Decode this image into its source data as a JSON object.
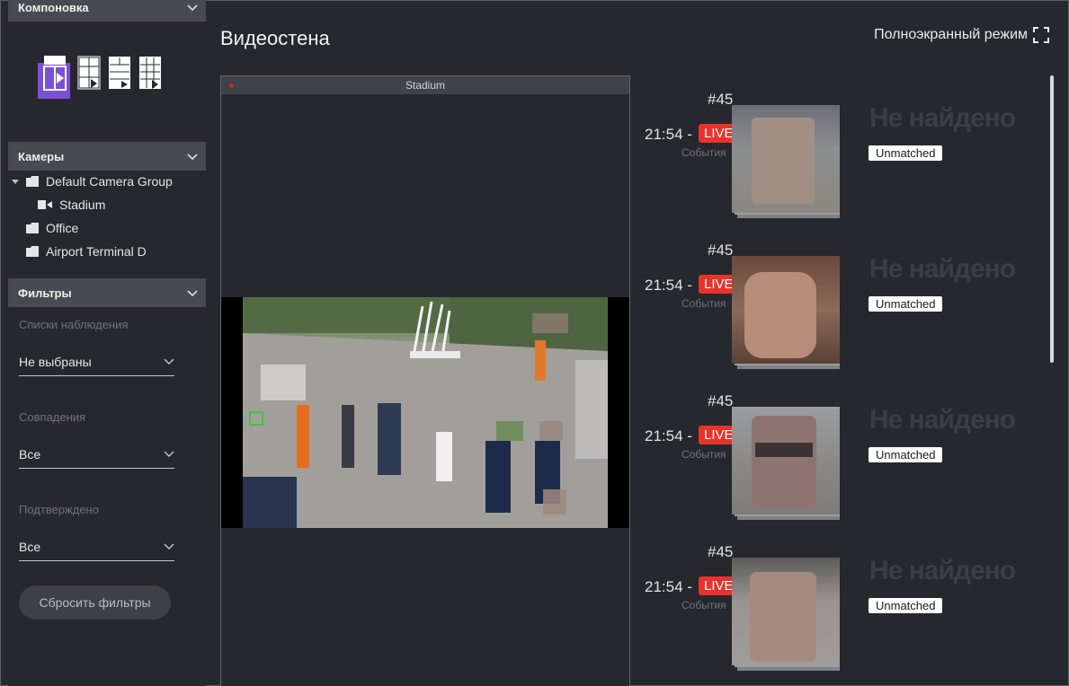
{
  "sidebar": {
    "layout_header": "Компоновка",
    "cameras_header": "Камеры",
    "tree": [
      {
        "label": "Default Camera Group"
      },
      {
        "label": "Stadium"
      },
      {
        "label": "Office"
      },
      {
        "label": "Airport Terminal D"
      }
    ],
    "filters_header": "Фильтры",
    "filters": [
      {
        "label": "Списки наблюдения",
        "value": "Не выбраны"
      },
      {
        "label": "Совпадения",
        "value": "Все"
      },
      {
        "label": "Подтверждено",
        "value": "Все"
      }
    ],
    "reset_label": "Сбросить фильтры"
  },
  "main": {
    "title": "Видеостена",
    "fullscreen_label": "Полноэкранный режим",
    "video_title": "Stadium"
  },
  "events": [
    {
      "id": "#45",
      "time": "21:54 -",
      "live": "LIVE",
      "camera": "События",
      "status": "Не найдено",
      "badge": "Unmatched"
    },
    {
      "id": "#45",
      "time": "21:54 -",
      "live": "LIVE",
      "camera": "События",
      "status": "Не найдено",
      "badge": "Unmatched"
    },
    {
      "id": "#45",
      "time": "21:54 -",
      "live": "LIVE",
      "camera": "События",
      "status": "Не найдено",
      "badge": "Unmatched"
    },
    {
      "id": "#45",
      "time": "21:54 -",
      "live": "LIVE",
      "camera": "События",
      "status": "Не найдено",
      "badge": "Unmatched"
    }
  ],
  "colors": {
    "accent": "#7b4fd6",
    "live": "#e8332c",
    "header_bg": "#464a51",
    "bg": "#26282d"
  }
}
